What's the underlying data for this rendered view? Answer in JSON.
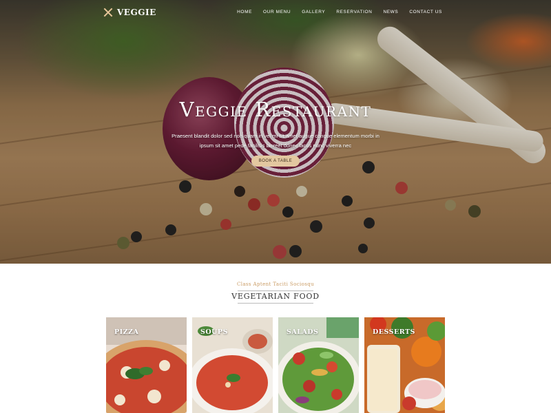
{
  "brand": {
    "name": "VEGGIE",
    "icon": "crossed-utensils-icon"
  },
  "nav": {
    "items": [
      "HOME",
      "OUR MENU",
      "GALLERY",
      "RESERVATION",
      "NEWS",
      "CONTACT US"
    ]
  },
  "hero": {
    "title": "Veggie Restaurant",
    "subtitle": "Praesent blandit dolor sed non quam in vel mi sit amet augue congue elementum morbi in ipsum sit amet pede facilisis laoreet donec lacus nunc viverra nec",
    "button": "BOOK A TABLE"
  },
  "section": {
    "kicker": "Class Aptent Taciti Sociosqu",
    "title": "VEGETARIAN FOOD"
  },
  "cards": [
    {
      "label": "PIZZA"
    },
    {
      "label": "SOUPS"
    },
    {
      "label": "SALADS"
    },
    {
      "label": "DESSERTS"
    }
  ],
  "colors": {
    "accent": "#e3c8a0",
    "kicker": "#c99a62",
    "text": "#333333"
  }
}
